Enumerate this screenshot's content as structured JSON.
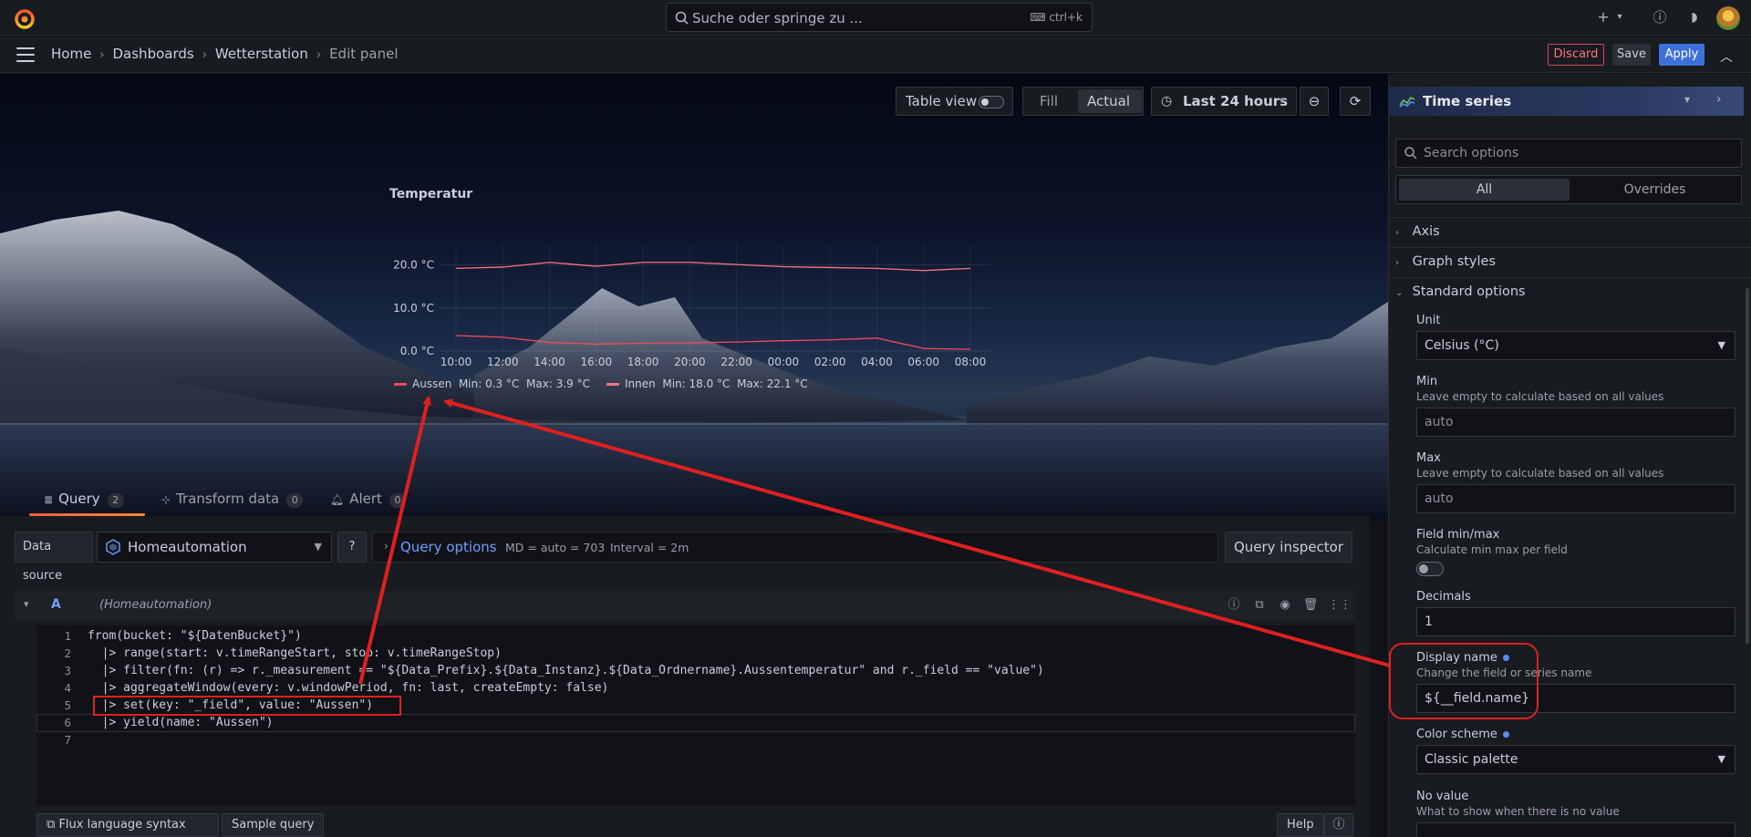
{
  "topbar": {
    "search_placeholder": "Suche oder springe zu ...",
    "search_shortcut": "ctrl+k"
  },
  "breadcrumb": {
    "items": [
      "Home",
      "Dashboards",
      "Wetterstation",
      "Edit panel"
    ]
  },
  "actions": {
    "discard": "Discard",
    "save": "Save",
    "apply": "Apply"
  },
  "panel_toolbar": {
    "table_view": "Table view",
    "fill": "Fill",
    "actual": "Actual",
    "time_range": "Last 24 hours"
  },
  "chart_data": {
    "type": "line",
    "title": "Temperatur",
    "x": [
      "10:00",
      "12:00",
      "14:00",
      "16:00",
      "18:00",
      "20:00",
      "22:00",
      "00:00",
      "02:00",
      "04:00",
      "06:00",
      "08:00"
    ],
    "ylim": [
      0,
      25
    ],
    "yticks": [
      "0.0 °C",
      "10.0 °C",
      "20.0 °C"
    ],
    "unit": "°C",
    "series": [
      {
        "name": "Aussen",
        "color": "#f2495c",
        "values": [
          3.6,
          3.2,
          2.0,
          1.6,
          1.8,
          1.9,
          2.1,
          2.4,
          2.6,
          3.0,
          0.6,
          0.4
        ],
        "min": "0.3 °C",
        "max": "3.9 °C"
      },
      {
        "name": "Innen",
        "color": "#ff7383",
        "values": [
          19.2,
          19.5,
          20.6,
          19.7,
          20.6,
          20.6,
          20.1,
          19.6,
          19.4,
          19.2,
          18.7,
          19.2
        ],
        "min": "18.0 °C",
        "max": "22.1 °C"
      }
    ],
    "legend_placement": "bottom-left"
  },
  "legend": {
    "s1_name": "Aussen",
    "s1_min": "Min: 0.3 °C",
    "s1_max": "Max: 3.9 °C",
    "s2_name": "Innen",
    "s2_min": "Min: 18.0 °C",
    "s2_max": "Max: 22.1 °C"
  },
  "tabs": [
    {
      "label": "Query",
      "count": "2"
    },
    {
      "label": "Transform data",
      "count": "0"
    },
    {
      "label": "Alert",
      "count": "0"
    }
  ],
  "query_bar": {
    "data_source_label": "Data source",
    "data_source": "Homeautomation",
    "query_options": "Query options",
    "md": "MD = auto = 703",
    "interval": "Interval = 2m",
    "inspector": "Query inspector"
  },
  "query": {
    "ref_id": "A",
    "ds_name": "(Homeautomation)",
    "lines": [
      "from(bucket: \"${DatenBucket}\")",
      "  |> range(start: v.timeRangeStart, stop: v.timeRangeStop)",
      "  |> filter(fn: (r) => r._measurement == \"${Data_Prefix}.${Data_Instanz}.${Data_Ordnername}.Aussentemperatur\" and r._field == \"value\")",
      "  |> aggregateWindow(every: v.windowPeriod, fn: last, createEmpty: false)",
      "  |> set(key: \"_field\", value: \"Aussen\")",
      "  |> yield(name: \"Aussen\")",
      ""
    ]
  },
  "footer": {
    "flux_syntax": "Flux language syntax",
    "sample_query": "Sample query",
    "help": "Help"
  },
  "options": {
    "viz": "Time series",
    "search_placeholder": "Search options",
    "seg_all": "All",
    "seg_overrides": "Overrides",
    "sections": [
      "Axis",
      "Graph styles",
      "Standard options"
    ],
    "unit_label": "Unit",
    "unit_value": "Celsius (°C)",
    "min_label": "Min",
    "min_desc": "Leave empty to calculate based on all values",
    "min_placeholder": "auto",
    "max_label": "Max",
    "max_desc": "Leave empty to calculate based on all values",
    "max_placeholder": "auto",
    "fieldminmax_label": "Field min/max",
    "fieldminmax_desc": "Calculate min max per field",
    "decimals_label": "Decimals",
    "decimals_value": "1",
    "display_name_label": "Display name",
    "display_name_desc": "Change the field or series name",
    "display_name_value": "${__field.name}",
    "color_scheme_label": "Color scheme",
    "color_scheme_value": "Classic palette",
    "novalue_label": "No value",
    "novalue_desc": "What to show when there is no value"
  },
  "colors": {
    "accent": "#3d71d9",
    "annotation": "#e02020"
  }
}
